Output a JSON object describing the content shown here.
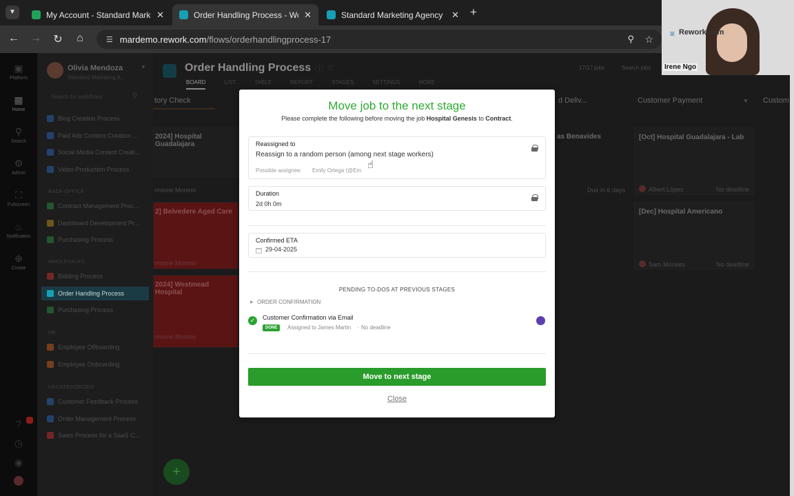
{
  "browser": {
    "tabs": [
      {
        "title": "My Account - Standard Marketi",
        "color": "#22a35a"
      },
      {
        "title": "Order Handling Process - Work",
        "color": "#17a0b5",
        "active": true
      },
      {
        "title": "Standard Marketing Agency",
        "color": "#17a0b5"
      }
    ],
    "url_host": "mardemo.rework.com",
    "url_path": "/flows/orderhandlingprocess-17"
  },
  "rail": [
    "Platform",
    "Home",
    "Search",
    "Admin",
    "Fullscreen",
    "Notification",
    "Create"
  ],
  "sidebar": {
    "user_name": "Olivia Mendoza",
    "org": "Standard Marketing A...",
    "search_placeholder": "Search for workflows",
    "items_top": [
      {
        "label": "Blog Creation Process",
        "color": "#2f6fd1"
      },
      {
        "label": "Paid Ads Content Creation ...",
        "color": "#2f6fd1"
      },
      {
        "label": "Social Media Content Creati...",
        "color": "#2f6fd1"
      },
      {
        "label": "Video Production Process",
        "color": "#2f6fd1"
      }
    ],
    "group_backoffice": "BACK-OFFICE",
    "items_backoffice": [
      {
        "label": "Contract Management Proc...",
        "color": "#2e9d48"
      },
      {
        "label": "Dashboard Development Pr...",
        "color": "#d39b1a"
      },
      {
        "label": "Purchasing Process",
        "color": "#2e9d48"
      }
    ],
    "group_wholesales": "WHOLESALES",
    "items_wholesales": [
      {
        "label": "Bidding Process",
        "color": "#d33"
      },
      {
        "label": "Order Handling Process",
        "color": "#17a0b5"
      },
      {
        "label": "Purchasing Process",
        "color": "#2e9d48"
      }
    ],
    "group_hr": "HR",
    "items_hr": [
      {
        "label": "Employee Offboarding",
        "color": "#e36b1b"
      },
      {
        "label": "Employee Onboarding",
        "color": "#e36b1b"
      }
    ],
    "group_uncat": "UNCATEGORIZED",
    "items_uncat": [
      {
        "label": "Customer Feedback Process",
        "color": "#2f6fd1"
      },
      {
        "label": "Order Management Process",
        "color": "#2f6fd1"
      },
      {
        "label": "Sales Process for a SaaS C...",
        "color": "#d33"
      }
    ]
  },
  "board": {
    "title": "Order Handling Process",
    "jobs_count": "17/17 jobs",
    "search": "Search jobs",
    "tabs": [
      "BOARD",
      "LIST",
      "TABLE",
      "REPORT",
      "STAGES",
      "SETTINGS",
      "MORE"
    ],
    "col1": "tory Check",
    "col_mid": "d Deliv...",
    "col_payment": "Customer Payment",
    "col_last": "Custom",
    "card1": "2024] Hospital Guadalajara",
    "card_red1": "2] Belvedere Aged Care",
    "card_red2": "2024] Westmead Hospital",
    "person1": "rmione Moreno",
    "mid_person": "as Benavides",
    "pay_card1": "[Oct] Hospital Guadalajara - Lab",
    "pay_card1_owner": "Albert López",
    "pay_card2": "[Dec] Hospital Americano",
    "pay_card2_owner": "Sam Morales",
    "no_deadline": "No deadline",
    "due": "Due in 6 days"
  },
  "modal": {
    "title": "Move job to the next stage",
    "subtitle_pre": "Please complete the following before moving the job ",
    "job": "Hospital Genesis",
    "subtitle_mid": " to ",
    "stage": "Contract",
    "subtitle_end": ".",
    "reassigned_label": "Reassigned to",
    "reassigned_value": "Reassign to a random person (among next stage workers)",
    "possible_label": "Possible assignee:",
    "possible_value": "Emily Ortega (@Em",
    "duration_label": "Duration",
    "duration_value": "2d 0h 0m",
    "eta_label": "Confirmed ETA",
    "eta_value": "29-04-2025",
    "pending_title": "PENDING TO-DOS AT PREVIOUS STAGES",
    "section": "ORDER CONFIRMATION",
    "todo_title": "Customer Confirmation via Email",
    "todo_badge": "DONE",
    "todo_assigned": "Assigned to James Martin",
    "todo_deadline": "No deadline",
    "move_button": "Move to next stage",
    "close_button": "Close"
  },
  "webcam": {
    "brand": "Rework.com",
    "name": "Irene Ngo"
  }
}
